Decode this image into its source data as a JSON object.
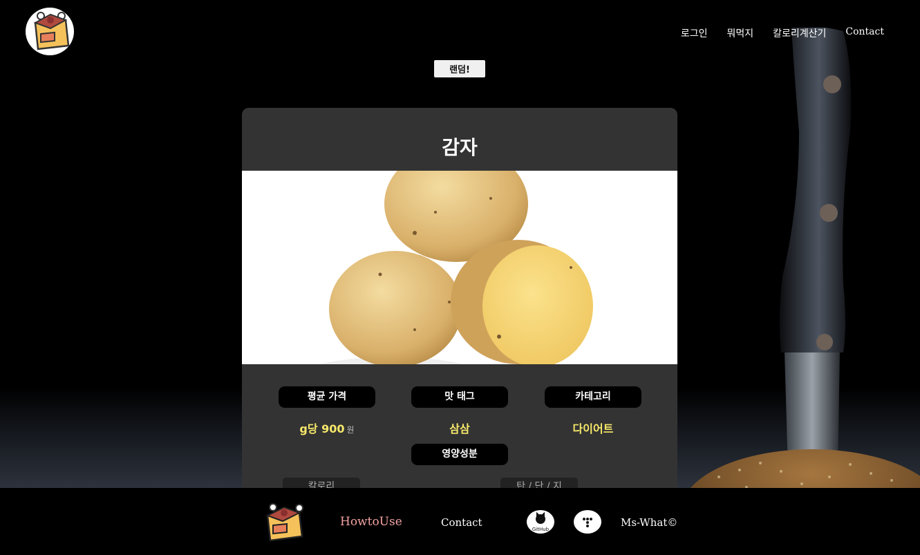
{
  "header": {
    "nav": [
      "로그인",
      "뭐먹지",
      "칼로리계산기",
      "Contact"
    ],
    "random_label": "랜덤!"
  },
  "food": {
    "name": "감자",
    "price_label": "평균 가격",
    "price_value": "g당 900",
    "price_unit": "원",
    "taste_label": "맛 태그",
    "taste_value": "삼삼",
    "category_label": "카테고리",
    "category_value": "다이어트",
    "nutrition_label": "영양성분",
    "calorie_label": "칼로리",
    "macro_label": "탄 / 단 / 지"
  },
  "footer": {
    "howto": "HowtoUse",
    "contact": "Contact",
    "github_label": "GitHub",
    "copyright": "Ms-What©"
  },
  "colors": {
    "accent_yellow": "#f6e86a",
    "howto_pink": "#f4a3a3",
    "card_bg": "#333333"
  },
  "icons": [
    "logo-icon",
    "github-icon",
    "tistory-icon",
    "knife-image",
    "potato-image"
  ]
}
